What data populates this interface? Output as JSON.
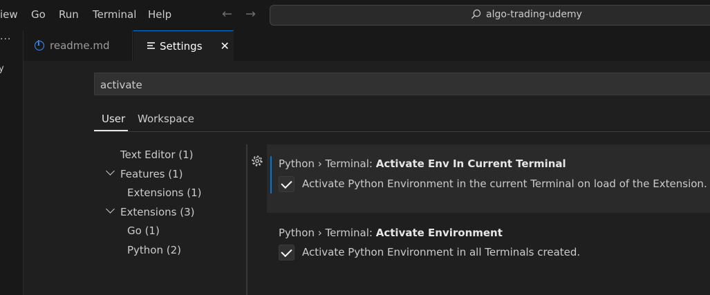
{
  "menu": [
    "iew",
    "Go",
    "Run",
    "Terminal",
    "Help"
  ],
  "command_center": {
    "text": "algo-trading-udemy"
  },
  "activity": {
    "more": "···",
    "fragment": "y"
  },
  "tabs": [
    {
      "label": "readme.md",
      "icon": "info-icon",
      "active": false
    },
    {
      "label": "Settings",
      "icon": "settings-icon",
      "active": true,
      "close": "✕"
    }
  ],
  "settings": {
    "search_value": "activate",
    "scopes": [
      "User",
      "Workspace"
    ],
    "active_scope": "User",
    "toc": [
      {
        "label": "Text Editor (1)",
        "level": 0,
        "expanded": null
      },
      {
        "label": "Features (1)",
        "level": 0,
        "expanded": true
      },
      {
        "label": "Extensions (1)",
        "level": 1,
        "expanded": null
      },
      {
        "label": "Extensions (3)",
        "level": 0,
        "expanded": true
      },
      {
        "label": "Go (1)",
        "level": 1,
        "expanded": null
      },
      {
        "label": "Python (2)",
        "level": 1,
        "expanded": null
      }
    ],
    "items": [
      {
        "category": "Python › Terminal: ",
        "name": "Activate Env In Current Terminal",
        "description": "Activate Python Environment in the current Terminal on load of the Extension.",
        "checked": true
      },
      {
        "category": "Python › Terminal: ",
        "name": "Activate Environment",
        "description": "Activate Python Environment in all Terminals created.",
        "checked": true
      }
    ]
  },
  "colors": {
    "accent": "#0078d4",
    "background": "#1f1f1f",
    "chrome": "#181818"
  }
}
